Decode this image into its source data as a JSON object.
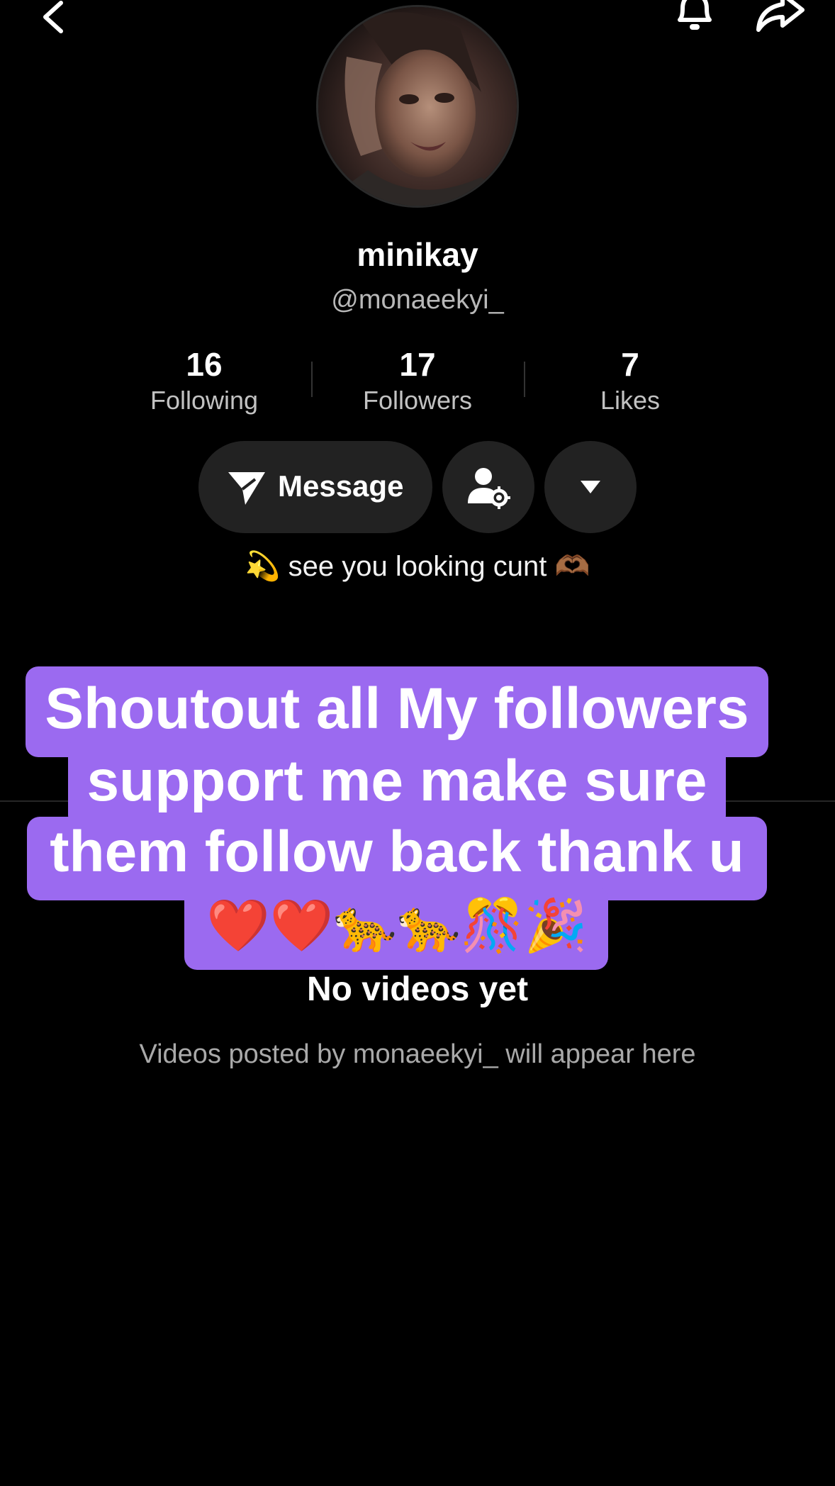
{
  "profile": {
    "display_name": "minikay",
    "username": "@monaeekyi_",
    "bio": "💫 see you looking cunt 🫶🏾"
  },
  "stats": [
    {
      "value": "16",
      "label": "Following"
    },
    {
      "value": "17",
      "label": "Followers"
    },
    {
      "value": "7",
      "label": "Likes"
    }
  ],
  "actions": {
    "message_label": "Message"
  },
  "icons": {
    "back": "chevron-left-icon",
    "notifications": "bell-icon",
    "share": "share-arrow-icon",
    "message": "paper-plane-icon",
    "friend_settings": "person-gear-icon",
    "more": "caret-down-icon"
  },
  "caption_overlay": {
    "lines": [
      "Shoutout all My followers",
      "support me make sure",
      "them follow back thank u",
      "❤️❤️🐆🐆🎊🎉"
    ],
    "background_color": "#9b6af0"
  },
  "empty_state": {
    "title": "No videos yet",
    "subtitle": "Videos posted by monaeekyi_ will appear here"
  },
  "colors": {
    "background": "#000000",
    "button_bg": "#222222",
    "secondary_text": "#b8b8b8"
  }
}
